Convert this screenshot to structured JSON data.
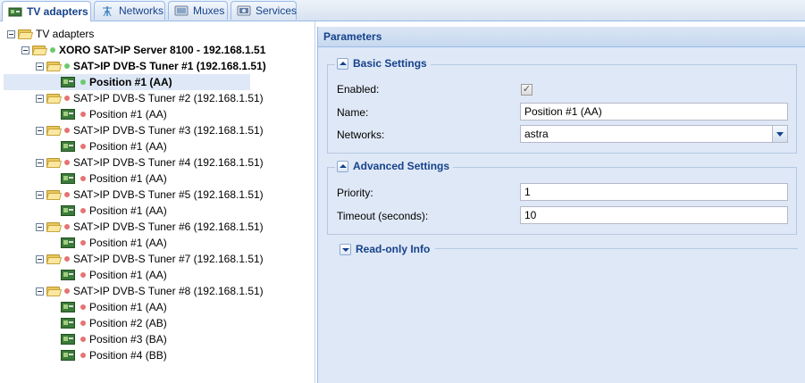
{
  "tabs": [
    {
      "label": "TV adapters",
      "icon": "tv-card-icon",
      "active": true
    },
    {
      "label": "Networks",
      "icon": "antenna-icon",
      "active": false
    },
    {
      "label": "Muxes",
      "icon": "mux-icon",
      "active": false
    },
    {
      "label": "Services",
      "icon": "services-icon",
      "active": false
    }
  ],
  "tree": {
    "root": "TV adapters",
    "server": "XORO SAT>IP Server 8100 - 192.168.1.51",
    "tuners": [
      {
        "label": "SAT>IP DVB-S Tuner #1 (192.168.1.51)",
        "status": "green",
        "positions": [
          "Position #1 (AA)"
        ]
      },
      {
        "label": "SAT>IP DVB-S Tuner #2 (192.168.1.51)",
        "status": "red",
        "positions": [
          "Position #1 (AA)"
        ]
      },
      {
        "label": "SAT>IP DVB-S Tuner #3 (192.168.1.51)",
        "status": "red",
        "positions": [
          "Position #1 (AA)"
        ]
      },
      {
        "label": "SAT>IP DVB-S Tuner #4 (192.168.1.51)",
        "status": "red",
        "positions": [
          "Position #1 (AA)"
        ]
      },
      {
        "label": "SAT>IP DVB-S Tuner #5 (192.168.1.51)",
        "status": "red",
        "positions": [
          "Position #1 (AA)"
        ]
      },
      {
        "label": "SAT>IP DVB-S Tuner #6 (192.168.1.51)",
        "status": "red",
        "positions": [
          "Position #1 (AA)"
        ]
      },
      {
        "label": "SAT>IP DVB-S Tuner #7 (192.168.1.51)",
        "status": "red",
        "positions": [
          "Position #1 (AA)"
        ]
      },
      {
        "label": "SAT>IP DVB-S Tuner #8 (192.168.1.51)",
        "status": "red",
        "positions": [
          "Position #1 (AA)",
          "Position #2 (AB)",
          "Position #3 (BA)",
          "Position #4 (BB)"
        ]
      }
    ],
    "selected": "Position #1 (AA)"
  },
  "parameters": {
    "title": "Parameters",
    "basic": {
      "legend": "Basic Settings",
      "enabled_label": "Enabled:",
      "enabled": true,
      "name_label": "Name:",
      "name_value": "Position #1 (AA)",
      "networks_label": "Networks:",
      "networks_value": "astra"
    },
    "advanced": {
      "legend": "Advanced Settings",
      "priority_label": "Priority:",
      "priority_value": "1",
      "timeout_label": "Timeout (seconds):",
      "timeout_value": "10"
    },
    "readonly": {
      "legend": "Read-only Info"
    }
  },
  "colors": {
    "status_active": "#6cc96c",
    "status_idle": "#e57373",
    "header_text": "#15428b",
    "panel_bg": "#dfe8f6"
  }
}
